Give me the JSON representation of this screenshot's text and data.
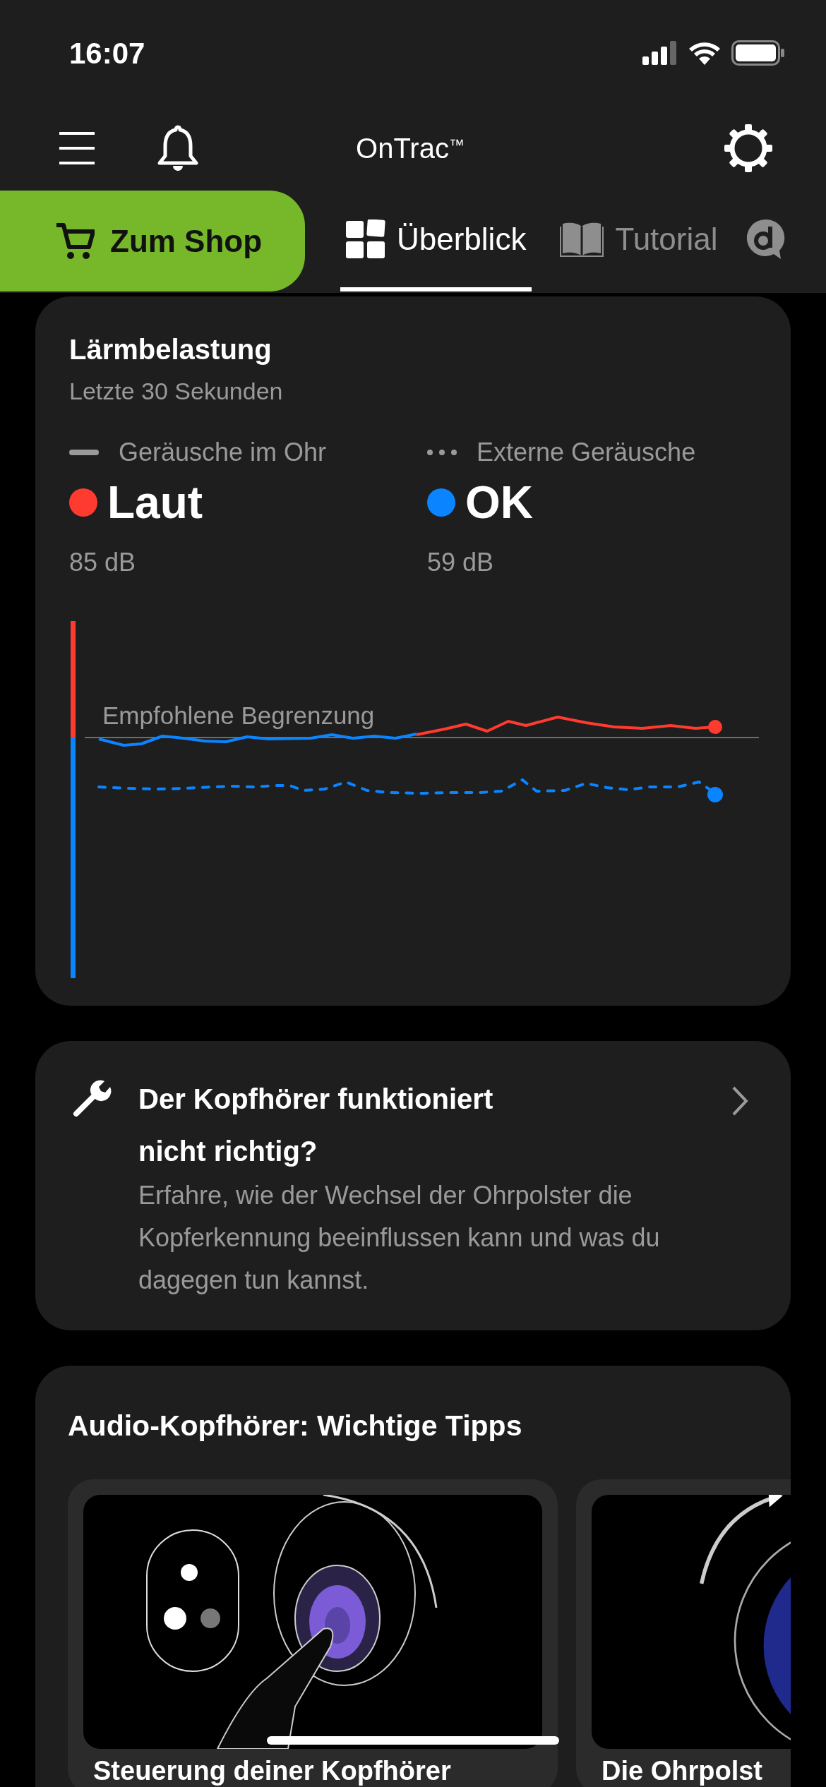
{
  "status_bar": {
    "time": "16:07"
  },
  "header": {
    "title": "OnTrac",
    "mark": "™"
  },
  "shop_button": {
    "label": "Zum Shop"
  },
  "tabs": [
    {
      "kind": "overview",
      "label": "Überblick",
      "selected": true
    },
    {
      "kind": "tutorial",
      "label": "Tutorial",
      "selected": false
    },
    {
      "kind": "chat",
      "selected": false
    }
  ],
  "noise_card": {
    "title": "Lärmbelastung",
    "subtitle": "Letzte 30 Sekunden",
    "legend": [
      {
        "kind": "solid",
        "label": "Geräusche im Ohr",
        "status": "Laut",
        "color": "#ff3b30",
        "reading": "85 dB"
      },
      {
        "kind": "dotted",
        "label": "Externe Geräusche",
        "status": "OK",
        "color": "#0a84ff",
        "reading": "59 dB"
      }
    ],
    "chart": {
      "limit_label": "Empfohlene Begrenzung"
    }
  },
  "help_card": {
    "title": "Der Kopfhörer funktioniert nicht richtig?",
    "body": "Erfahre, wie der Wechsel der Ohrpolster die Kopferkennung beeinflussen kann und was du dagegen tun kannst."
  },
  "tips": {
    "title": "Audio-Kopfhörer: Wichtige Tipps",
    "items": [
      {
        "kind": "picture",
        "title": "Steuerung deiner Kopfhörer"
      },
      {
        "kind": "picture",
        "title": "Die Ohrpolst"
      }
    ]
  }
}
